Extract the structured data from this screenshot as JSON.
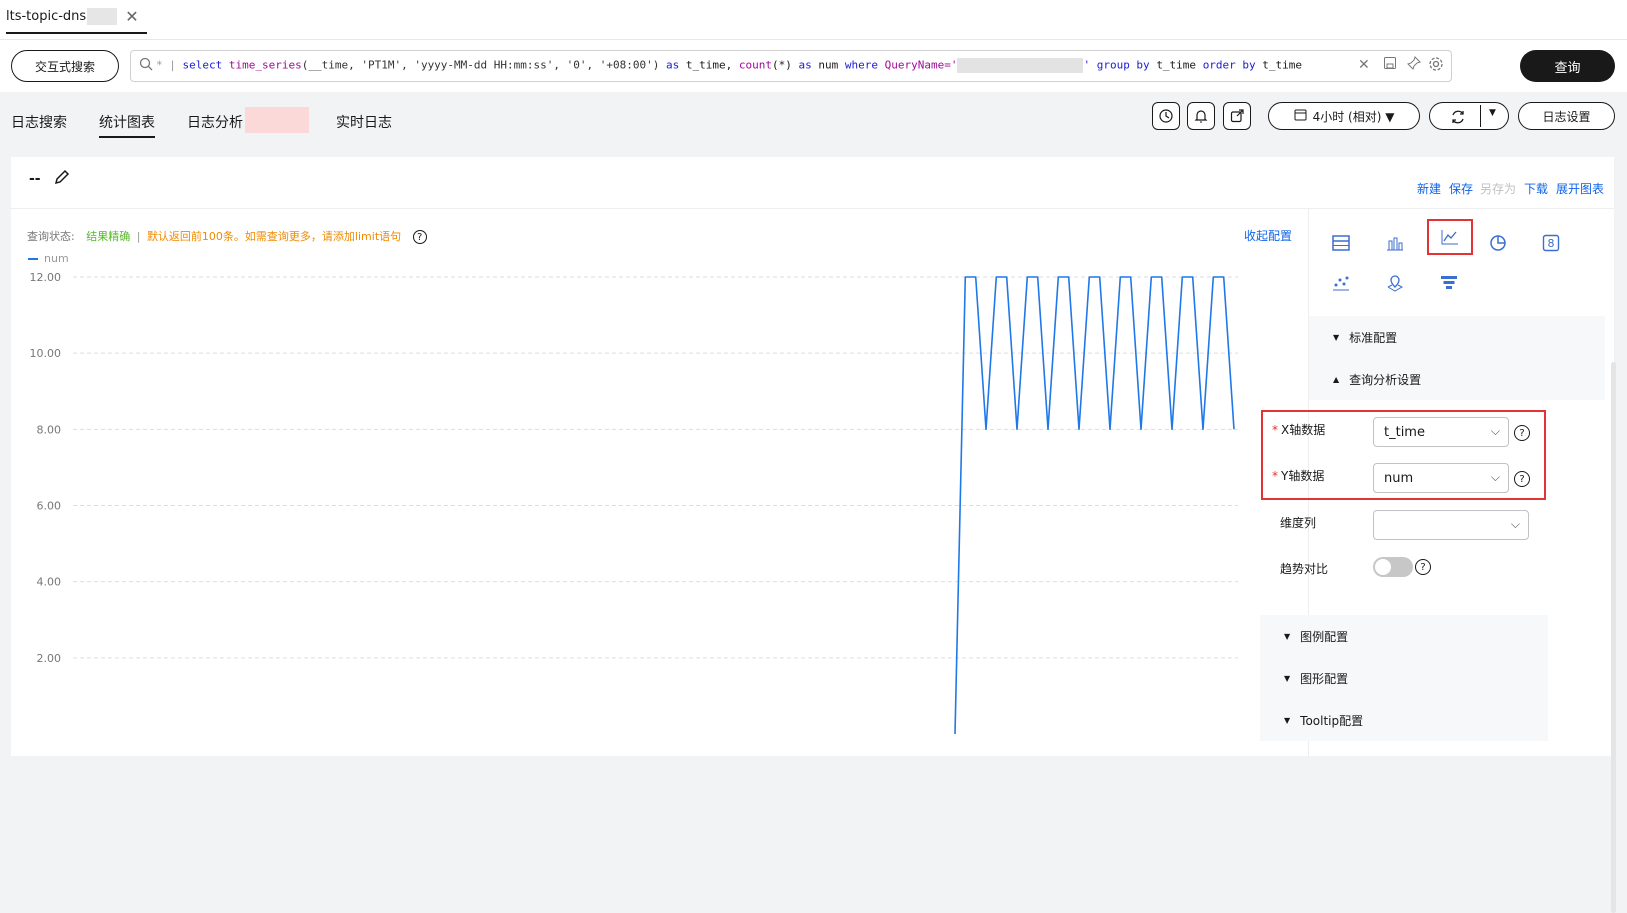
{
  "doc_tab": {
    "title": "lts-topic-dns"
  },
  "query": {
    "mode_button": "交互式搜索",
    "prefix": "*",
    "sql_parts": [
      "select",
      "time_series",
      "(__time, 'PT1M', 'yyyy-MM-dd HH:mm:ss', '0', '+08:00')",
      "as",
      "t_time,",
      "count",
      "(*)",
      "as",
      "num",
      "where",
      "QueryName='",
      "' group by",
      "t_time",
      "order by",
      "t_time"
    ],
    "search_button": "查询"
  },
  "nav": {
    "tabs": [
      "日志搜索",
      "统计图表",
      "日志分析",
      "实时日志"
    ],
    "active": "统计图表",
    "time_range": "4小时 (相对) ▼",
    "settings_button": "日志设置"
  },
  "panel": {
    "title": "--",
    "actions": {
      "new": "新建",
      "save": "保存",
      "save_as": "另存为",
      "download": "下载",
      "expand": "展开图表"
    },
    "status_label": "查询状态:",
    "status_ok": "结果精确",
    "status_sep": "|",
    "status_warn": "默认返回前100条。如需查询更多，请添加limit语句",
    "collapse_config": "收起配置"
  },
  "config": {
    "sections": {
      "standard": "标准配置",
      "query_analysis": "查询分析设置",
      "legend": "图例配置",
      "graph": "图形配置",
      "tooltip": "Tooltip配置"
    },
    "x_label": "X轴数据",
    "x_value": "t_time",
    "y_label": "Y轴数据",
    "y_value": "num",
    "dim_label": "维度列",
    "dim_value": "",
    "trend_label": "趋势对比",
    "trend_on": false,
    "chart_types": [
      "table-icon",
      "bar-chart-icon",
      "line-chart-icon",
      "pie-chart-icon",
      "number-icon",
      "scatter-icon",
      "map-icon",
      "funnel-icon"
    ],
    "selected_chart_type": "line-chart-icon",
    "colors": {
      "accent": "#0f64e8",
      "highlight": "#e53333",
      "line": "#1f78e8"
    }
  },
  "chart_data": {
    "type": "line",
    "series": [
      {
        "name": "num",
        "values": [
          0,
          12,
          12,
          8,
          12,
          12,
          8,
          12,
          12,
          8,
          12,
          12,
          8,
          12,
          12,
          8,
          12,
          12,
          8,
          12,
          12,
          8,
          12,
          12,
          8,
          12,
          12,
          8
        ]
      }
    ],
    "yticks": [
      "12.00",
      "10.00",
      "8.00",
      "6.00",
      "4.00",
      "2.00"
    ],
    "ylim": [
      0,
      12
    ],
    "grid": true,
    "legend": "top-left"
  }
}
